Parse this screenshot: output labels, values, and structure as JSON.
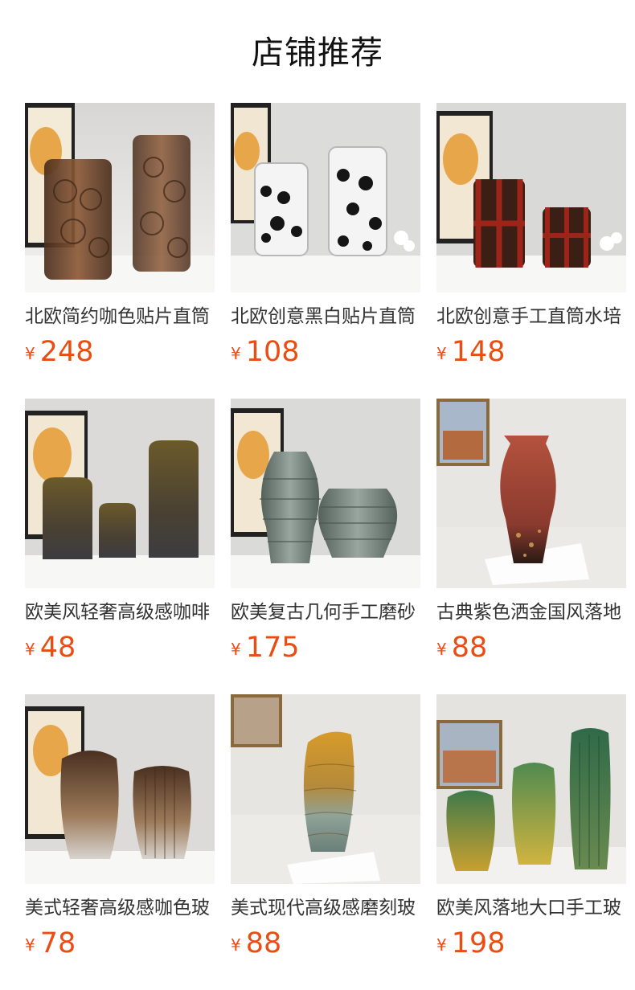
{
  "header": {
    "title": "店铺推荐"
  },
  "currency": "¥",
  "accent_color": "#ea4d14",
  "products": [
    {
      "name": "北欧简约咖色贴片直筒",
      "price": "248",
      "image": "two-brown-bubble-vases"
    },
    {
      "name": "北欧创意黑白贴片直筒",
      "price": "108",
      "image": "two-clear-black-dot-vases"
    },
    {
      "name": "北欧创意手工直筒水培",
      "price": "148",
      "image": "two-red-cage-vases"
    },
    {
      "name": "欧美风轻奢高级感咖啡",
      "price": "48",
      "image": "three-brown-speckled-vases"
    },
    {
      "name": "欧美复古几何手工磨砂",
      "price": "175",
      "image": "two-grey-green-ribbed-vases"
    },
    {
      "name": "古典紫色洒金国风落地",
      "price": "88",
      "image": "tall-purple-gold-vase"
    },
    {
      "name": "美式轻奢高级感咖色玻",
      "price": "78",
      "image": "two-brown-gradient-vases"
    },
    {
      "name": "美式现代高级感磨刻玻",
      "price": "88",
      "image": "amber-green-carved-vase"
    },
    {
      "name": "欧美风落地大口手工玻",
      "price": "198",
      "image": "three-green-yellow-vases"
    }
  ]
}
